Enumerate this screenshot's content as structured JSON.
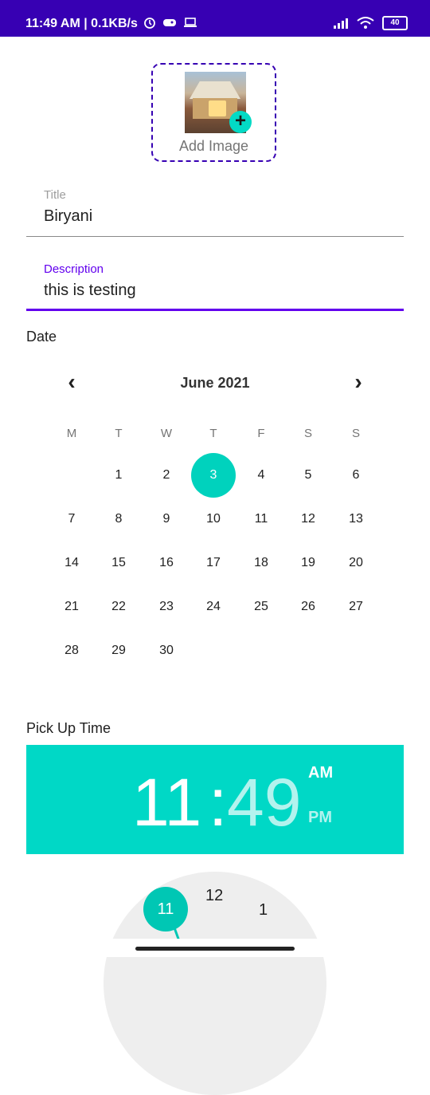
{
  "status_bar": {
    "time": "11:49 AM | 0.1KB/s",
    "battery": "40"
  },
  "image_picker": {
    "label": "Add Image"
  },
  "form": {
    "title_label": "Title",
    "title_value": "Biryani",
    "description_label": "Description",
    "description_value": "this is testing"
  },
  "date_section": {
    "label": "Date",
    "month_label": "June 2021",
    "weekdays": [
      "M",
      "T",
      "W",
      "T",
      "F",
      "S",
      "S"
    ],
    "selected_day": "3",
    "weeks": [
      [
        "",
        "1",
        "2",
        "3",
        "4",
        "5",
        "6"
      ],
      [
        "7",
        "8",
        "9",
        "10",
        "11",
        "12",
        "13"
      ],
      [
        "14",
        "15",
        "16",
        "17",
        "18",
        "19",
        "20"
      ],
      [
        "21",
        "22",
        "23",
        "24",
        "25",
        "26",
        "27"
      ],
      [
        "28",
        "29",
        "30",
        "",
        "",
        "",
        ""
      ]
    ]
  },
  "time_section": {
    "label": "Pick Up Time",
    "hour": "11",
    "colon": ":",
    "minute": "49",
    "am": "AM",
    "pm": "PM",
    "clock_numbers": {
      "selected": "11",
      "twelve": "12",
      "one": "1"
    }
  },
  "colors": {
    "primary": "#3700b3",
    "accent": "#00d8c6",
    "focus": "#6200ee"
  }
}
